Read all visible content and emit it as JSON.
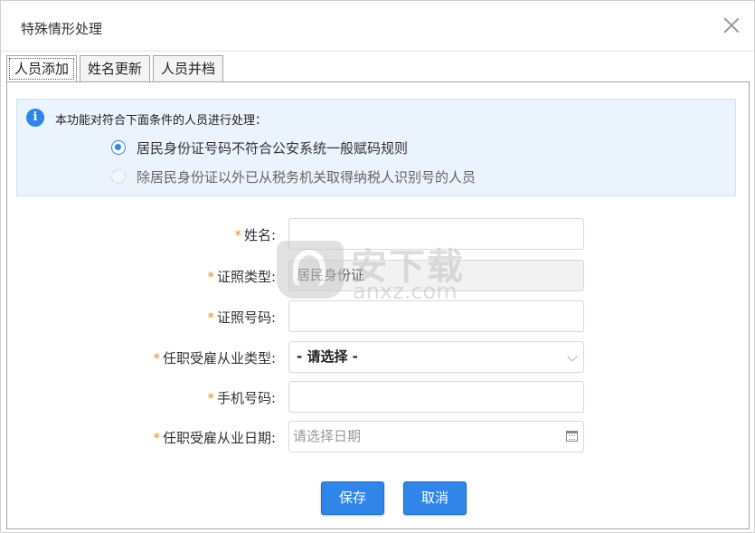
{
  "dialog": {
    "title": "特殊情形处理",
    "close_icon": "close-icon"
  },
  "tabs": [
    {
      "label": "人员添加",
      "active": true
    },
    {
      "label": "姓名更新",
      "active": false
    },
    {
      "label": "人员并档",
      "active": false
    }
  ],
  "notice": {
    "icon": "info-icon",
    "icon_glyph": "i",
    "text": "本功能对符合下面条件的人员进行处理：",
    "options": [
      {
        "label": "居民身份证号码不符合公安系统一般赋码规则",
        "checked": true,
        "disabled": false
      },
      {
        "label": "除居民身份证以外已从税务机关取得纳税人识别号的人员",
        "checked": false,
        "disabled": true
      }
    ]
  },
  "form": {
    "required_mark": "*",
    "name": {
      "label": "姓名:",
      "value": ""
    },
    "id_type": {
      "label": "证照类型:",
      "value": "居民身份证"
    },
    "id_number": {
      "label": "证照号码:",
      "value": ""
    },
    "employment_type": {
      "label": "任职受雇从业类型:",
      "value": "- 请选择 -"
    },
    "mobile": {
      "label": "手机号码:",
      "value": ""
    },
    "employment_date": {
      "label": "任职受雇从业日期:",
      "placeholder": "请选择日期"
    }
  },
  "buttons": {
    "save": "保存",
    "cancel": "取消"
  },
  "watermark": {
    "cn": "安下载",
    "en": "anxz.com"
  },
  "colors": {
    "accent": "#2f86e8",
    "required": "#f08a1d",
    "notice_bg": "#ebf3fc"
  }
}
